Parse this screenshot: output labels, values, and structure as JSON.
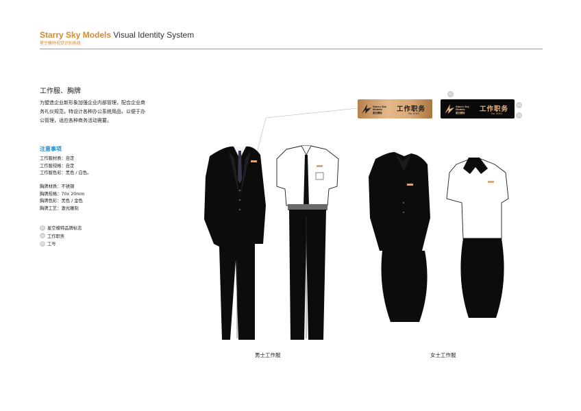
{
  "header": {
    "brand_orange": "Starry Sky Models",
    "brand_dark": " Visual Identity System",
    "subtitle": "星空模特视觉识别系统"
  },
  "section": {
    "title": "工作服、胸牌",
    "intro": "为塑造企业新形象加强企业内部管理，配合企业商务礼仪规范，特设计各种办公系统用品，以便于办公管理，适应各种商务活动需要。",
    "notes_title": "注意事项",
    "uniform_specs": [
      "工作服材质：自定",
      "工作服规格：自定",
      "工作服色彩：黑色 / 白色。"
    ],
    "badge_specs": [
      "胸牌材质：不锈钢",
      "胸牌规格：70x 20mm",
      "胸牌色彩：黑色 / 金色",
      "胸牌工艺：激光雕刻"
    ],
    "legend": [
      {
        "num": "01",
        "label": "星空模特品牌标志"
      },
      {
        "num": "02",
        "label": "工作职务"
      },
      {
        "num": "03",
        "label": "工号"
      }
    ]
  },
  "badges": {
    "logo_text_line1": "Starry Sky",
    "logo_text_line2": "Models",
    "logo_text_cn": "星空模特",
    "title": "工作职务",
    "number": "No. 0001"
  },
  "callouts": [
    "01",
    "02",
    "03"
  ],
  "captions": {
    "men": "男士工作服",
    "women": "女士工作服"
  },
  "colors": {
    "accent_orange": "#d8892a",
    "notes_blue": "#1e8fd6",
    "badge_gold": "#d9a978",
    "badge_black": "#0a0a0a"
  }
}
